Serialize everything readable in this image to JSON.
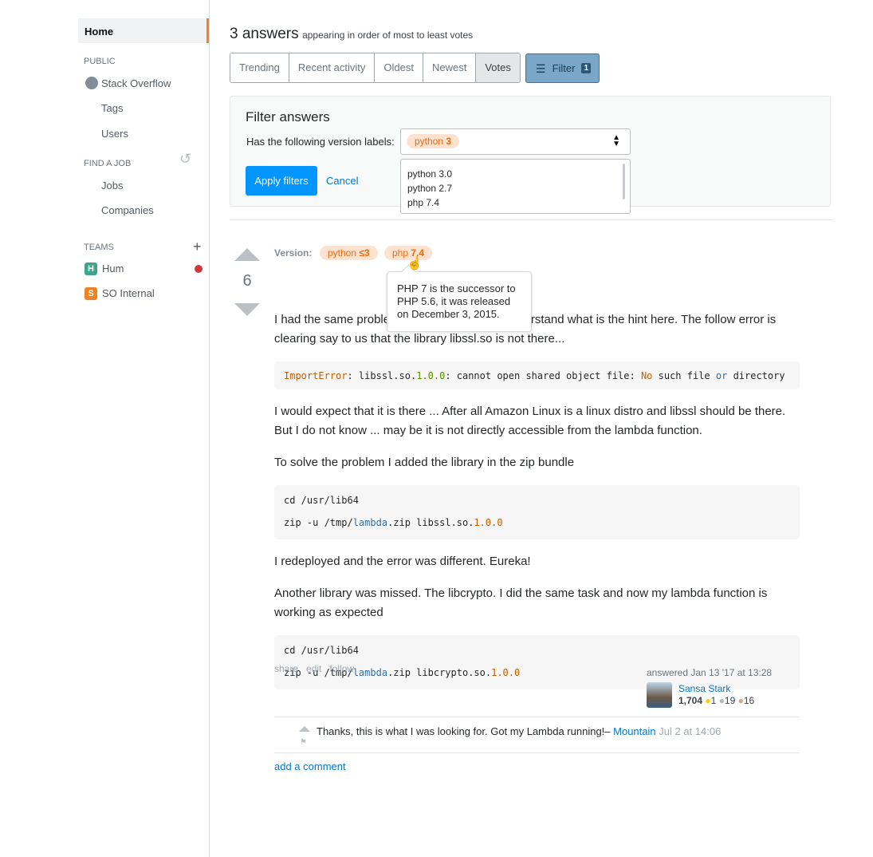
{
  "sidebar": {
    "home": "Home",
    "public_heading": "PUBLIC",
    "stack_overflow": "Stack Overflow",
    "tags": "Tags",
    "users": "Users",
    "jobs_heading": "FIND A JOB",
    "jobs": "Jobs",
    "companies": "Companies",
    "teams_heading": "TEAMS",
    "teams": [
      {
        "label": "Hum",
        "letter": "H",
        "color": "#3ea58c"
      },
      {
        "label": "SO Internal",
        "letter": "S",
        "color": "#f48024"
      }
    ],
    "notification_color": "#d1383d"
  },
  "header": {
    "count": "3 answers",
    "subtitle": "appearing in order of most to least votes"
  },
  "tabs": [
    {
      "label": "Trending"
    },
    {
      "label": "Recent activity"
    },
    {
      "label": "Oldest"
    },
    {
      "label": "Newest"
    },
    {
      "label": "Votes",
      "active": true
    }
  ],
  "filter_button": {
    "label": "Filter",
    "count": "1"
  },
  "filter_panel": {
    "title": "Filter answers",
    "field_label": "Has the following version labels:",
    "selected_prefix": "python",
    "selected_value": "3",
    "options": [
      "python 3.0",
      "python 2.7",
      "php 7.4"
    ],
    "apply": "Apply filters",
    "cancel": "Cancel"
  },
  "answer": {
    "votes": "6",
    "version_label": "Version:",
    "tags": [
      {
        "prefix": "python",
        "value": "≤3"
      },
      {
        "prefix": "php",
        "value": "7.4"
      }
    ],
    "tooltip": "PHP 7 is the successor to PHP 5.6, it was released on December 3, 2015.",
    "p1": "I had the same problem and I did not really understand what is the hint here. The follow error is clearing say to us that the library libssl.so is not there...",
    "code1": [
      [
        [
          "ImportError",
          "c-o"
        ],
        [
          ": libssl.so.",
          ""
        ],
        [
          "1.0.0",
          "c-g"
        ],
        [
          ": cannot open shared object file: ",
          ""
        ],
        [
          "No",
          "c-o"
        ],
        [
          " such file ",
          ""
        ],
        [
          "or",
          "c-b"
        ],
        [
          " directory",
          ""
        ]
      ]
    ],
    "p2": "I would expect that it is there ... After all Amazon Linux is a linux distro and libssl should be there. But I do not know ... may be it is not directly accessible from the lambda function.",
    "p3": "To solve the problem I added the library in the zip bundle",
    "code2": [
      [
        [
          "cd /usr/lib64",
          ""
        ]
      ],
      [
        [
          "zip -u /tmp/",
          ""
        ],
        [
          "lambda",
          "c-b"
        ],
        [
          ".zip libssl.so.",
          ""
        ],
        [
          "1.0.0",
          "c-o"
        ]
      ]
    ],
    "p4": "I redeployed and the error was different. Eureka!",
    "p5": "Another library was missed. The libcrypto. I did the same task and now my lambda function is working as expected",
    "code3": [
      [
        [
          "cd /usr/lib64",
          ""
        ]
      ],
      [
        [
          "zip -u /tmp/",
          ""
        ],
        [
          "lambda",
          "c-b"
        ],
        [
          ".zip libcrypto.so.",
          ""
        ],
        [
          "1.0.0",
          "c-o"
        ]
      ]
    ],
    "actions": {
      "share": "share",
      "edit": "edit",
      "follow": "follow"
    },
    "signature": {
      "answered": "answered Jan 13 '17 at 13:28",
      "user": "Sansa Stark",
      "rep": "1,704",
      "gold": "1",
      "silver": "19",
      "bronze": "16"
    },
    "comment": {
      "text": "Thanks, this is what I was looking for. Got my Lambda running!–",
      "user": "Mountain",
      "date": "Jul 2 at 14:06"
    },
    "add_comment": "add a comment"
  }
}
